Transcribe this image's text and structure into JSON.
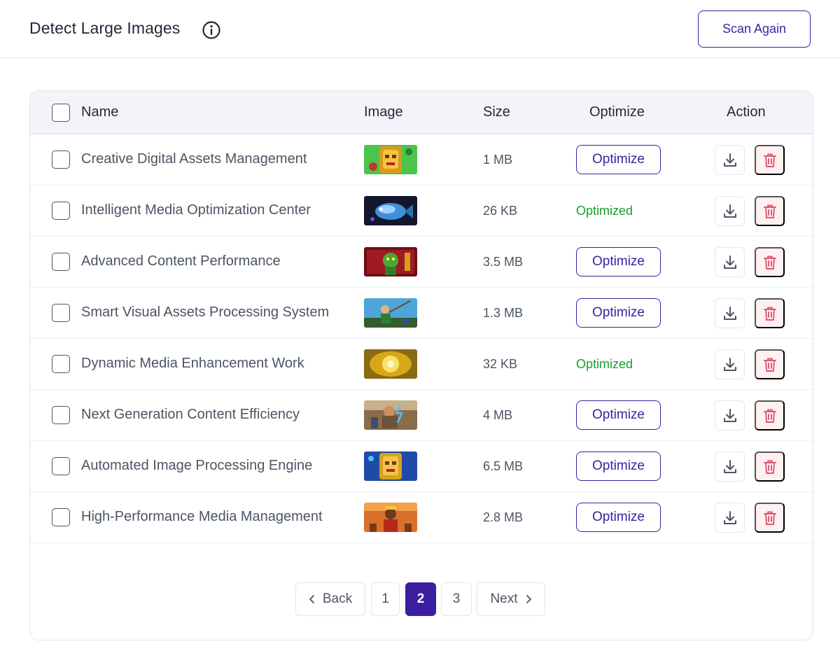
{
  "header": {
    "title": "Detect Large Images",
    "scan_button": "Scan Again"
  },
  "table": {
    "columns": {
      "name": "Name",
      "image": "Image",
      "size": "Size",
      "optimize": "Optimize",
      "action": "Action"
    },
    "optimize_label": "Optimize",
    "optimized_label": "Optimized",
    "rows": [
      {
        "name": "Creative Digital Assets Management",
        "size": "1 MB",
        "optimized": false,
        "thumb": "aztec-mask-green"
      },
      {
        "name": "Intelligent Media Optimization Center",
        "size": "26 KB",
        "optimized": true,
        "thumb": "blue-fish-dark"
      },
      {
        "name": "Advanced Content Performance",
        "size": "3.5 MB",
        "optimized": false,
        "thumb": "green-goblin-red"
      },
      {
        "name": "Smart Visual Assets Processing System",
        "size": "1.3 MB",
        "optimized": false,
        "thumb": "fisherman-sky"
      },
      {
        "name": "Dynamic Media Enhancement Work",
        "size": "32 KB",
        "optimized": true,
        "thumb": "golden-sun"
      },
      {
        "name": "Next Generation Content Efficiency",
        "size": "4 MB",
        "optimized": false,
        "thumb": "zeus-warrior"
      },
      {
        "name": "Automated Image Processing Engine",
        "size": "6.5 MB",
        "optimized": false,
        "thumb": "aztec-mask-blue"
      },
      {
        "name": "High-Performance Media Management",
        "size": "2.8 MB",
        "optimized": false,
        "thumb": "aztec-queen-orange"
      }
    ]
  },
  "pagination": {
    "back": "Back",
    "next": "Next",
    "pages": [
      "1",
      "2",
      "3"
    ],
    "current": "2"
  },
  "colors": {
    "accent": "#3b1fa0",
    "success": "#16a02a",
    "danger": "#e0556e"
  }
}
